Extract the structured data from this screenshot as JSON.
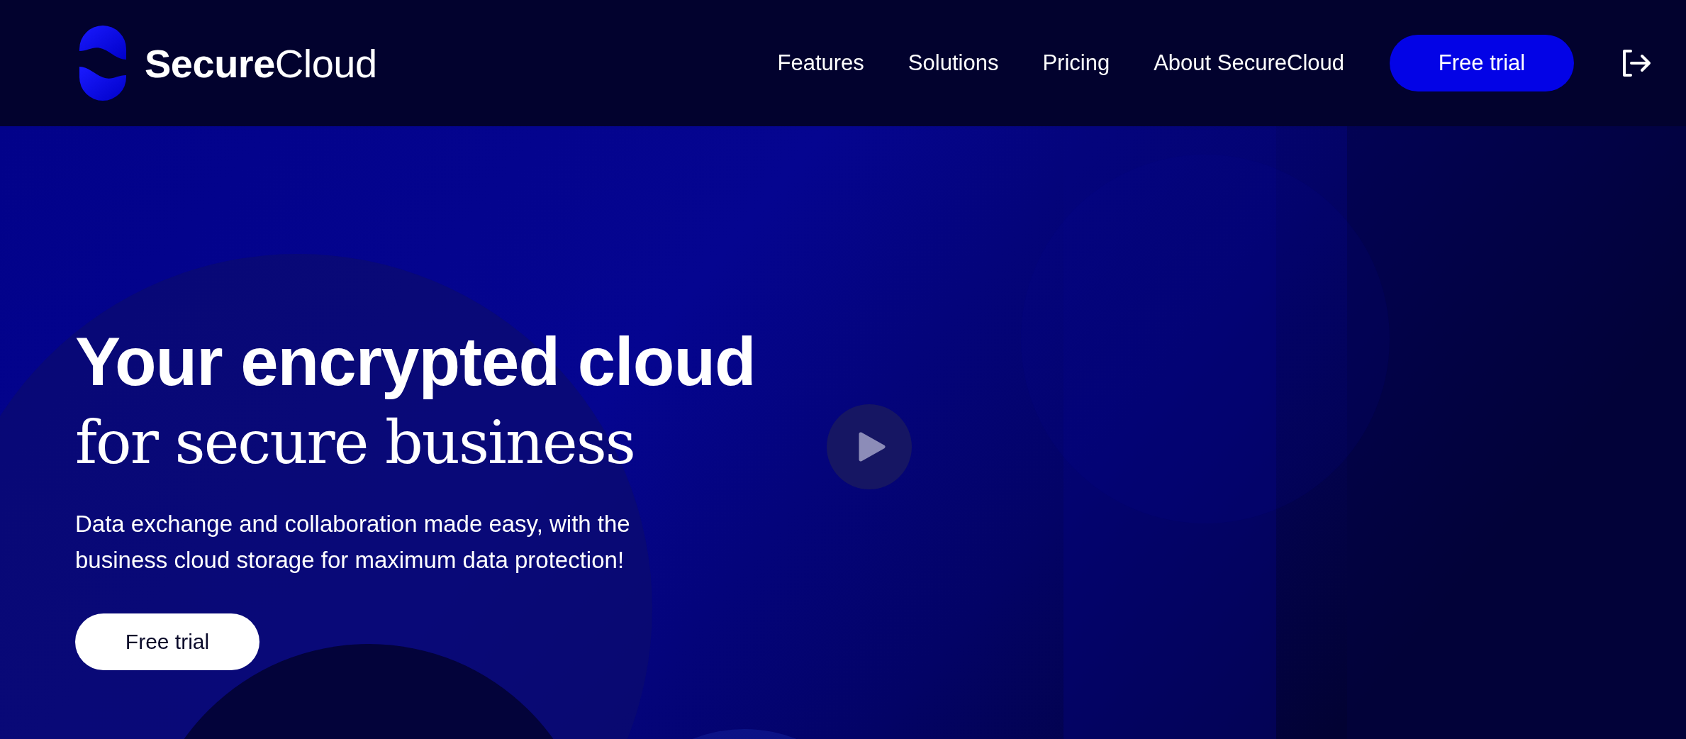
{
  "header": {
    "logo": "**Secure**Cloud",
    "nav": [
      {
        "label": "Features"
      },
      {
        "label": "Solutions"
      },
      {
        "label": "Pricing"
      },
      {
        "label": "About SecureCloud"
      }
    ],
    "cta": "Free trial"
  },
  "hero": {
    "headline": "Your encrypted cloud",
    "subheadline": "for secure business",
    "description": [
      "Data exchange and collaboration made easy, with the",
      "business cloud storage for maximum data protection!"
    ],
    "button": "Free trial"
  }
}
